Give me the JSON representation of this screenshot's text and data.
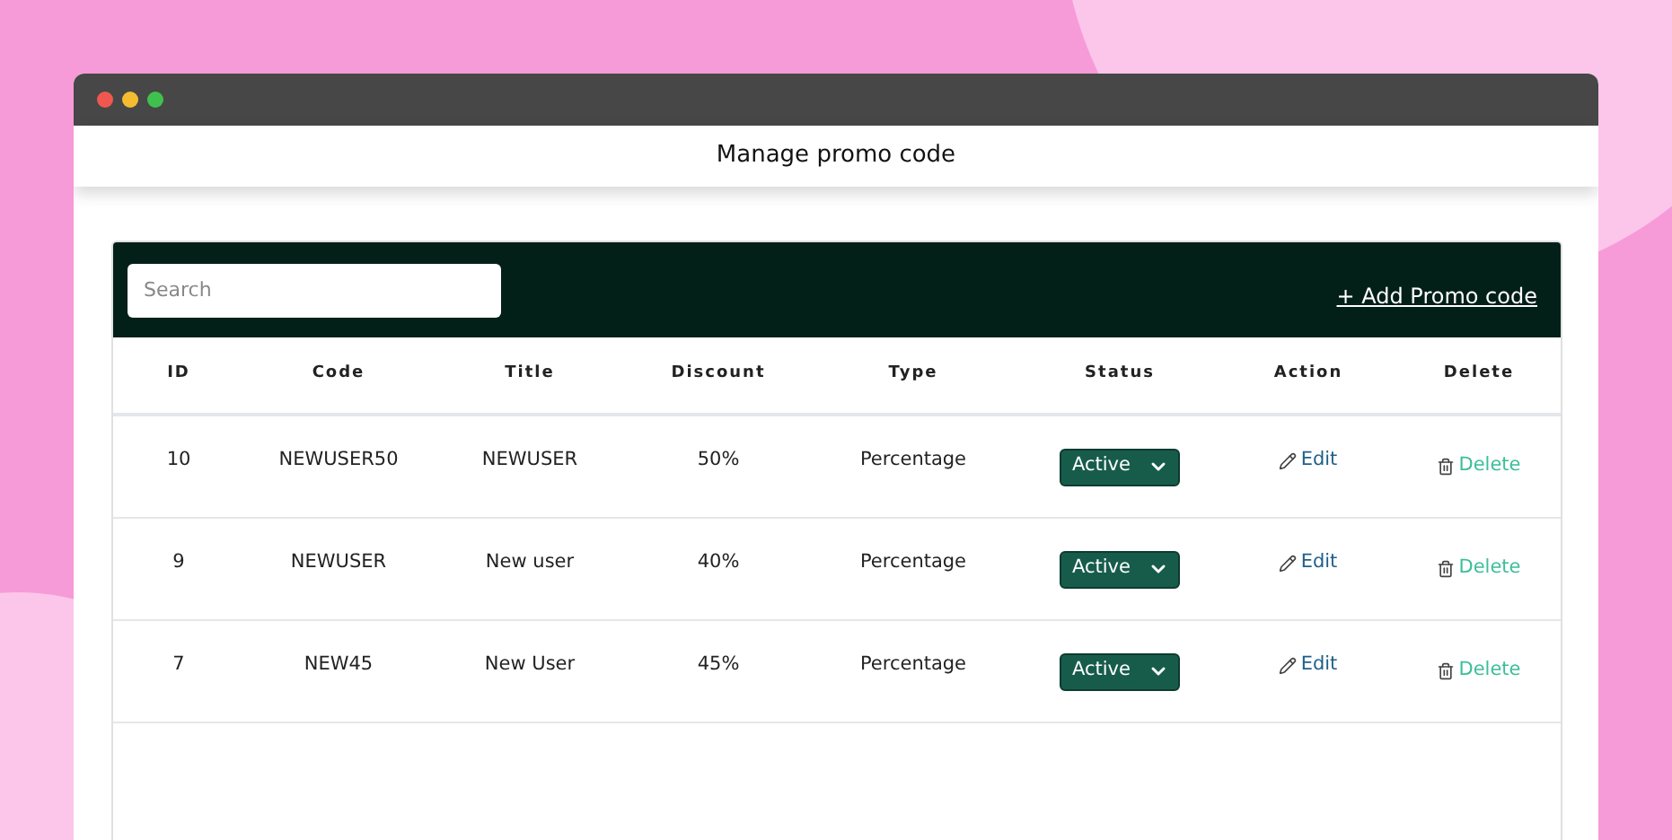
{
  "page_title": "Manage promo code",
  "search": {
    "placeholder": "Search"
  },
  "add_link": "+ Add Promo code",
  "table": {
    "columns": [
      "ID",
      "Code",
      "Title",
      "Discount",
      "Type",
      "Status",
      "Action",
      "Delete"
    ],
    "rows": [
      {
        "id": "10",
        "code": "NEWUSER50",
        "title": "NEWUSER",
        "discount": "50%",
        "type": "Percentage",
        "status": "Active",
        "edit": "Edit",
        "delete": "Delete"
      },
      {
        "id": "9",
        "code": "NEWUSER",
        "title": "New user",
        "discount": "40%",
        "type": "Percentage",
        "status": "Active",
        "edit": "Edit",
        "delete": "Delete"
      },
      {
        "id": "7",
        "code": "NEW45",
        "title": "New User",
        "discount": "45%",
        "type": "Percentage",
        "status": "Active",
        "edit": "Edit",
        "delete": "Delete"
      }
    ]
  }
}
